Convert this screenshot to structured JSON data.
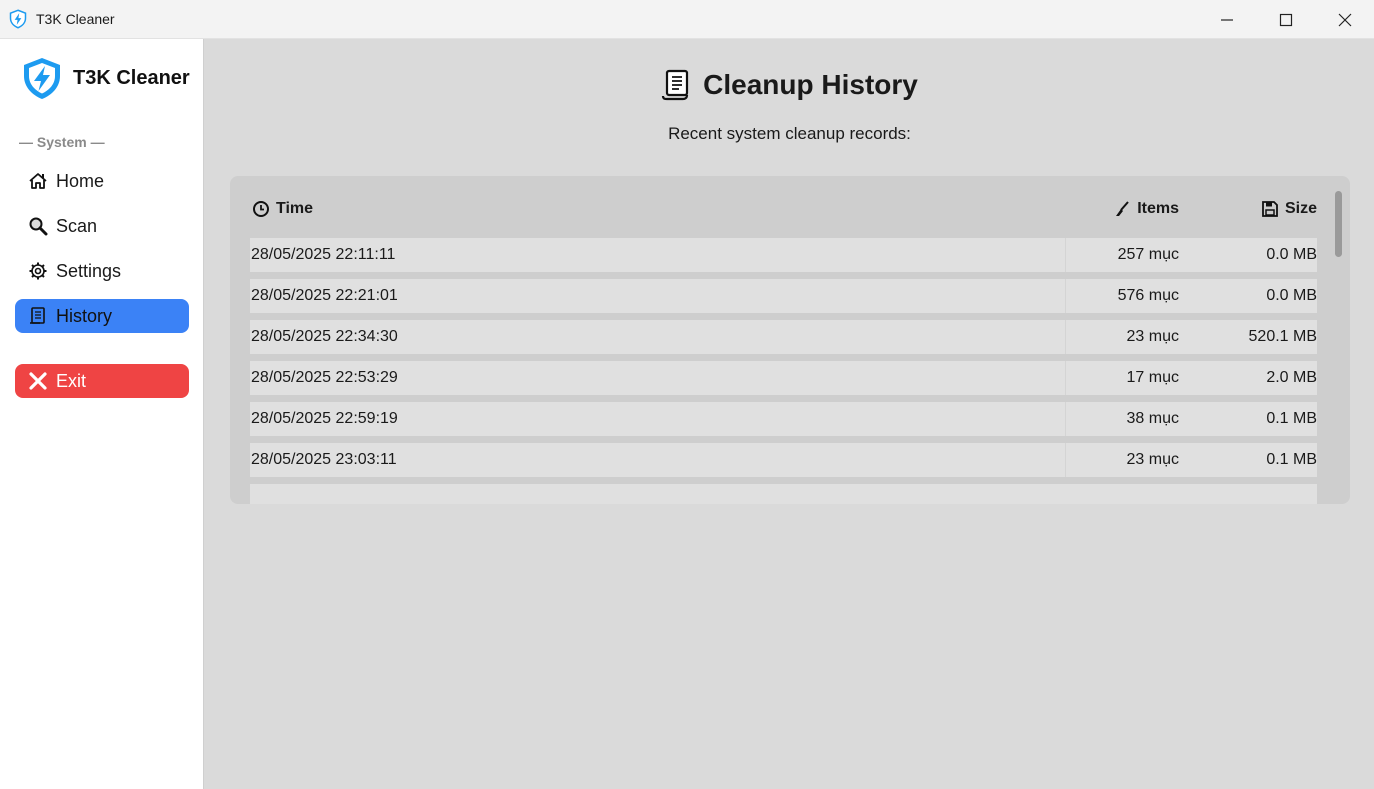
{
  "window": {
    "title": "T3K Cleaner"
  },
  "sidebar": {
    "brand": "T3K Cleaner",
    "section_label": "— System —",
    "items": [
      {
        "label": "Home",
        "icon": "home-icon"
      },
      {
        "label": "Scan",
        "icon": "magnifier-icon"
      },
      {
        "label": "Settings",
        "icon": "gear-icon"
      },
      {
        "label": "History",
        "icon": "scroll-icon",
        "active": true
      }
    ],
    "exit_label": "Exit"
  },
  "main": {
    "title": "Cleanup History",
    "subtitle": "Recent system cleanup records:",
    "table": {
      "headers": {
        "time": "Time",
        "items": "Items",
        "size": "Size"
      },
      "rows": [
        {
          "time": "28/05/2025 22:11:11",
          "items": "257 mục",
          "size": "0.0 MB"
        },
        {
          "time": "28/05/2025 22:21:01",
          "items": "576 mục",
          "size": "0.0 MB"
        },
        {
          "time": "28/05/2025 22:34:30",
          "items": "23 mục",
          "size": "520.1 MB"
        },
        {
          "time": "28/05/2025 22:53:29",
          "items": "17 mục",
          "size": "2.0 MB"
        },
        {
          "time": "28/05/2025 22:59:19",
          "items": "38 mục",
          "size": "0.1 MB"
        },
        {
          "time": "28/05/2025 23:03:11",
          "items": "23 mục",
          "size": "0.1 MB"
        }
      ]
    }
  },
  "colors": {
    "active": "#3b82f6",
    "exit": "#ef4444",
    "brand": "#1d9bf0"
  }
}
